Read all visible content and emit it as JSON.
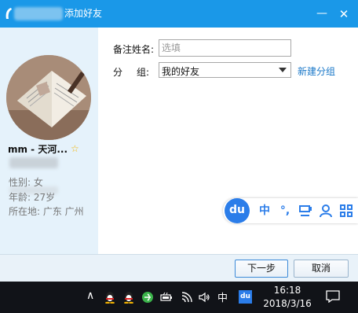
{
  "window": {
    "title": "添加好友",
    "minimize_label": "—",
    "close_label": "✕"
  },
  "profile": {
    "nickname": "mm - 天河...",
    "star_icon": "star-icon",
    "gender": "性别: 女",
    "age": "年龄: 27岁",
    "location": "所在地: 广东  广州"
  },
  "form": {
    "remark_label": "备注姓名:",
    "remark_placeholder": "选填",
    "remark_value": "",
    "group_label_1": "分",
    "group_label_2": "组:",
    "group_value": "我的好友",
    "new_group_link": "新建分组"
  },
  "ime_bar": {
    "logo": "du",
    "lang": "中",
    "punct": "°,"
  },
  "buttons": {
    "next": "下一步",
    "cancel": "取消"
  },
  "taskbar": {
    "caret": "∧",
    "ime_lang": "中",
    "du_label": "du",
    "time": "16:18",
    "date": "2018/3/16"
  },
  "colors": {
    "titlebar": "#1a98e8",
    "left_panel": "#e5f2fb",
    "link": "#1a78c8",
    "ime_blue": "#2b7de9",
    "taskbar": "#111318"
  }
}
